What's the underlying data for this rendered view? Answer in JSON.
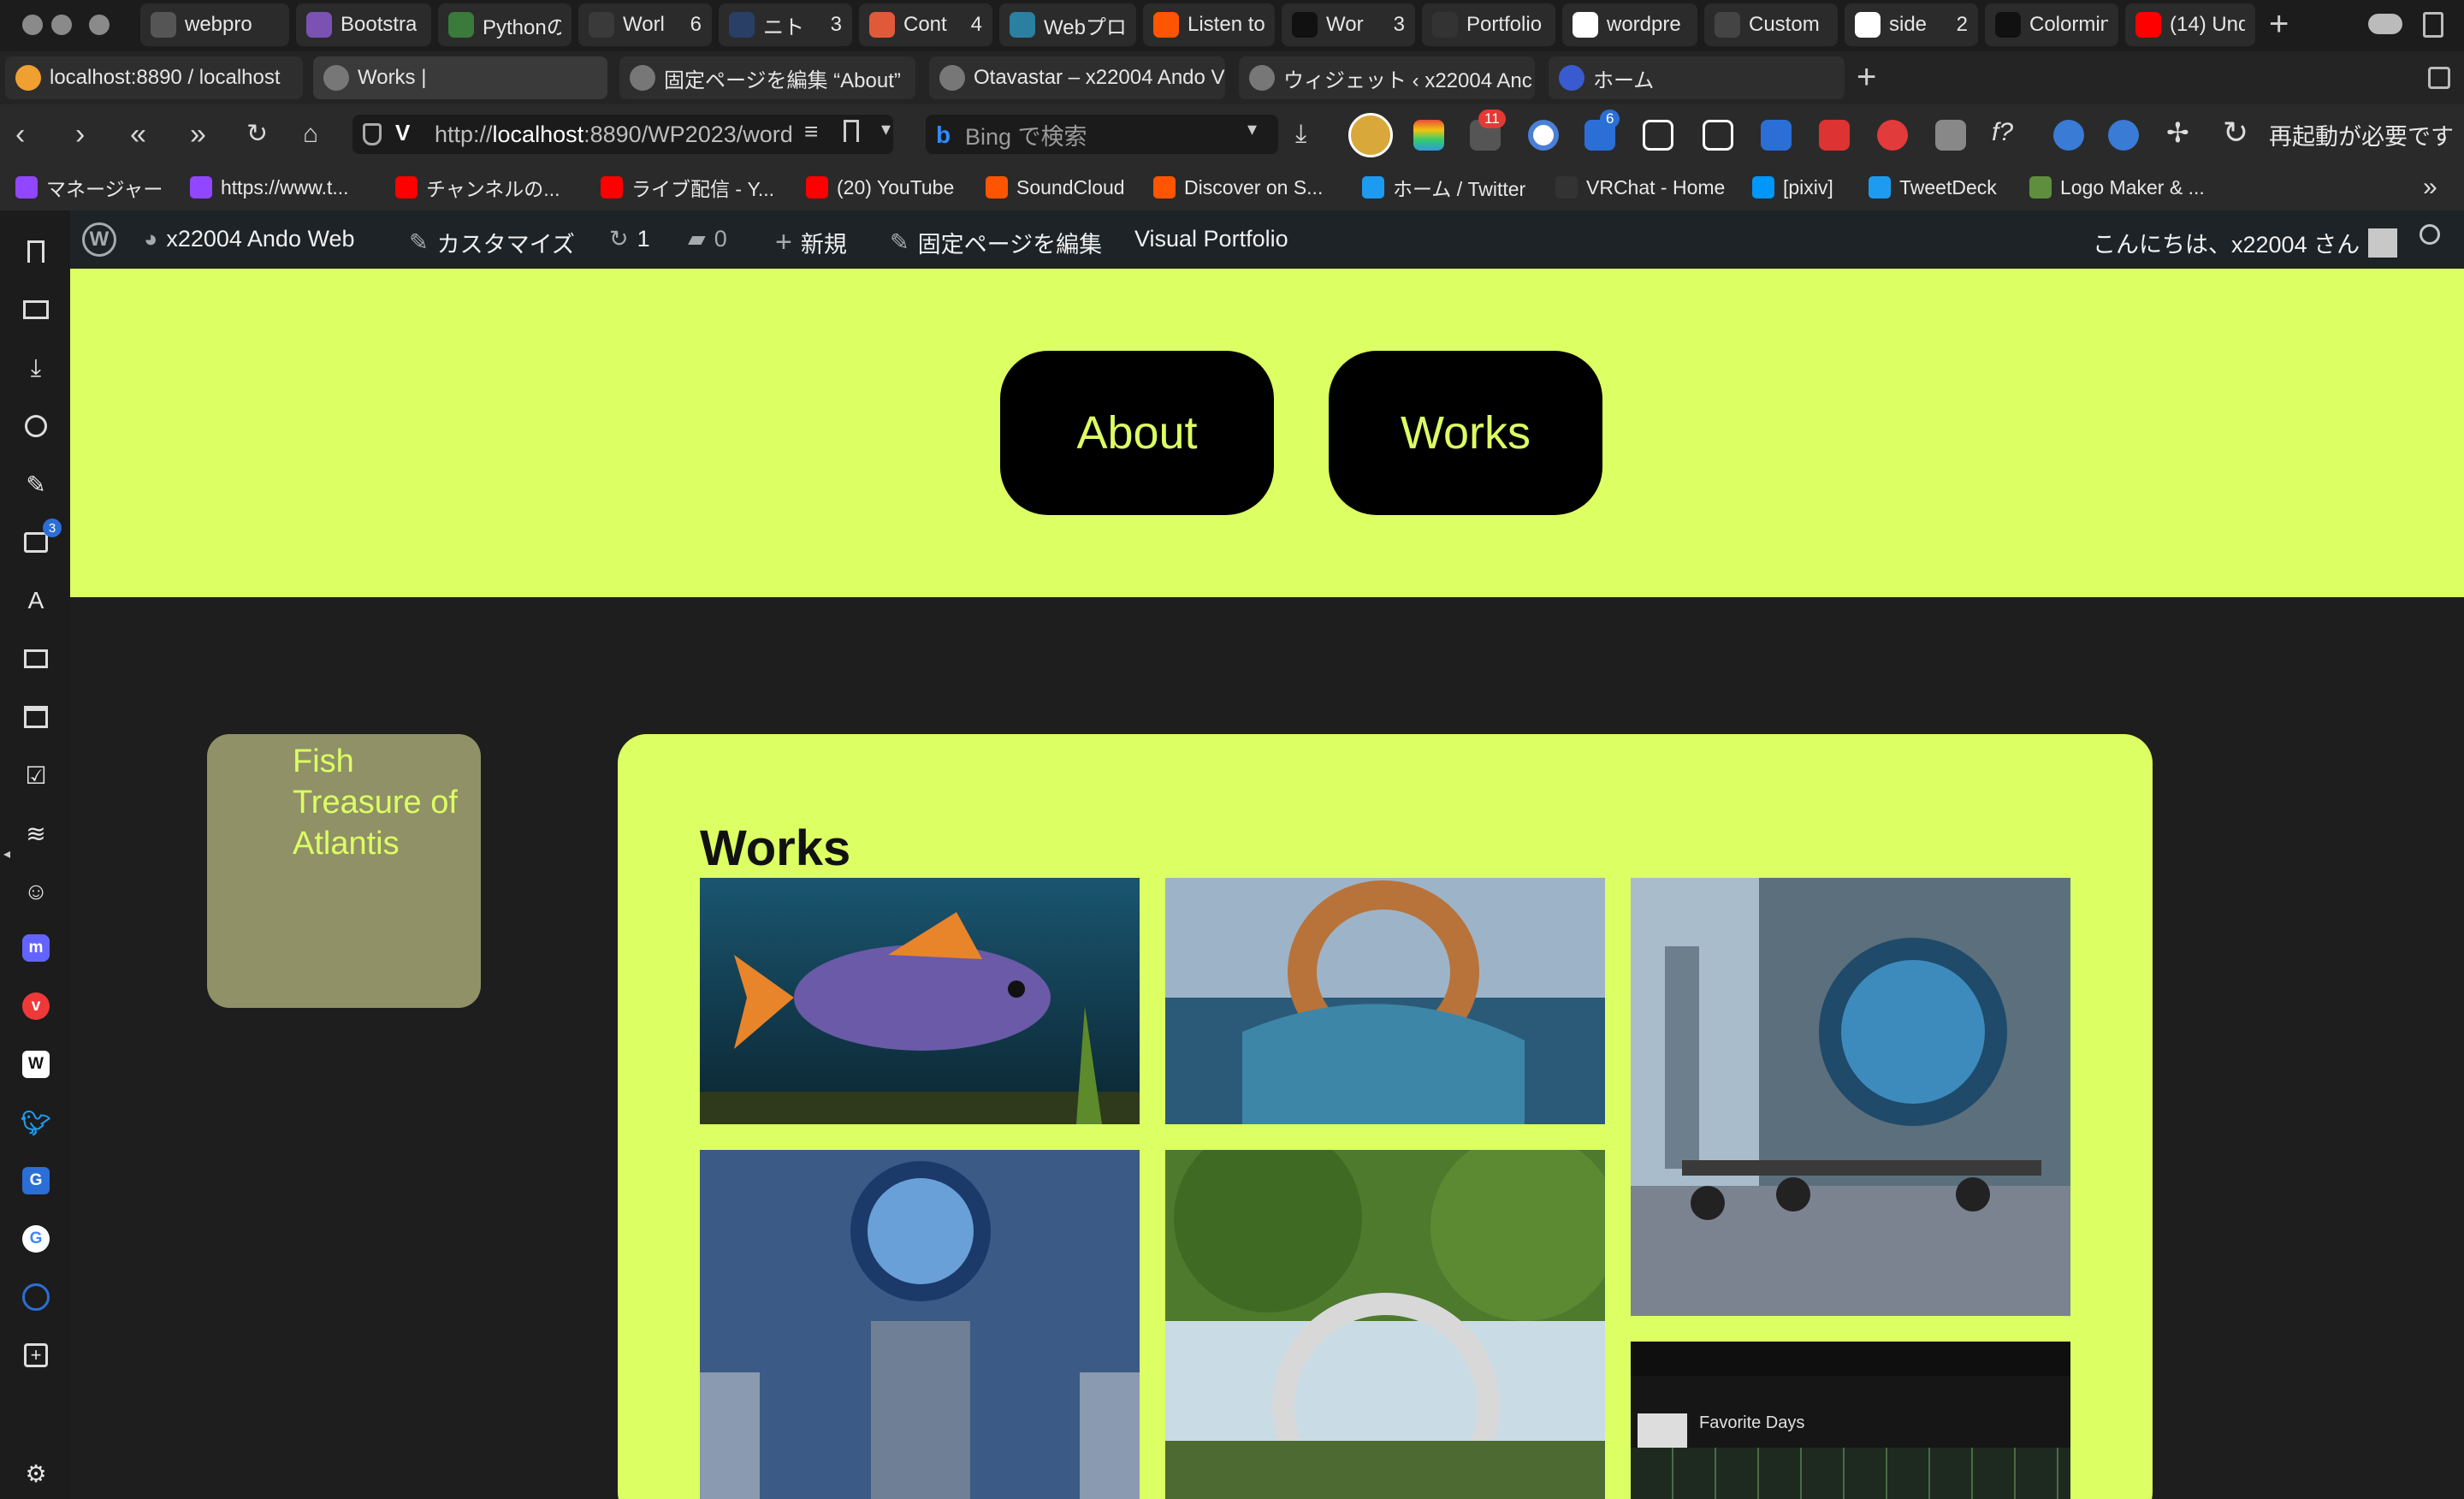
{
  "tabstrip": {
    "tabs": [
      {
        "label": "webpro",
        "count": "",
        "icon": "workspace-icon",
        "color": "#555555"
      },
      {
        "label": "Bootstra",
        "count": "",
        "icon": "bootstrap-icon",
        "color": "#7952b3"
      },
      {
        "label": "Pythonの",
        "count": "",
        "icon": "python-icon",
        "color": "#3a7a3a"
      },
      {
        "label": "Worl",
        "count": "6",
        "icon": "wordpress-icon",
        "color": "#3a3a3a"
      },
      {
        "label": "ニト",
        "count": "3",
        "icon": "search-icon",
        "color": "#2a3f66"
      },
      {
        "label": "Cont",
        "count": "4",
        "icon": "eg-icon",
        "color": "#e05a3a"
      },
      {
        "label": "Webプロ",
        "count": "",
        "icon": "sp-icon",
        "color": "#2b7fa1"
      },
      {
        "label": "Listen to",
        "count": "",
        "icon": "soundcloud-icon",
        "color": "#ff5500"
      },
      {
        "label": "Wor",
        "count": "3",
        "icon": "github-icon",
        "color": "#111111"
      },
      {
        "label": "Portfolio",
        "count": "",
        "icon": "portfolio-icon",
        "color": "#333333"
      },
      {
        "label": "wordpre",
        "count": "",
        "icon": "google-icon",
        "color": "#ffffff"
      },
      {
        "label": "Custom",
        "count": "",
        "icon": "doc-icon",
        "color": "#444444"
      },
      {
        "label": "side",
        "count": "2",
        "icon": "google-icon",
        "color": "#ffffff"
      },
      {
        "label": "Colormin",
        "count": "",
        "icon": "colormind-icon",
        "color": "#111111"
      },
      {
        "label": "(14) Und",
        "count": "",
        "icon": "youtube-icon",
        "color": "#ff0000"
      }
    ]
  },
  "tabrow2": {
    "tabs": [
      {
        "label": "localhost:8890 / localhost",
        "icon": "phpmyadmin-icon"
      },
      {
        "label": "Works |",
        "icon": "wordpress-icon"
      },
      {
        "label": "固定ページを編集 “About”",
        "icon": "wordpress-icon"
      },
      {
        "label": "Otavastar – x22004 Ando V",
        "icon": "wordpress-icon"
      },
      {
        "label": "ウィジェット ‹ x22004 Anc",
        "icon": "wordpress-icon"
      },
      {
        "label": "ホーム",
        "icon": "home-site-icon"
      }
    ]
  },
  "address": {
    "url_host": "localhost",
    "url_prefix": "http://",
    "url_suffix": ":8890/WP2023/word",
    "search_placeholder": "Bing で検索",
    "restart_label": "再起動が必要です",
    "ext_badge_1": "11",
    "ext_badge_2": "6"
  },
  "bookmarks": [
    {
      "label": "マネージャー",
      "icon": "twitch-icon",
      "color": "#9146ff"
    },
    {
      "label": "https://www.t...",
      "icon": "twitch-icon",
      "color": "#9146ff"
    },
    {
      "label": "チャンネルの...",
      "icon": "youtube-icon",
      "color": "#ff0000"
    },
    {
      "label": "ライブ配信 - Y...",
      "icon": "youtube-icon",
      "color": "#ff0000"
    },
    {
      "label": "(20) YouTube",
      "icon": "youtube-icon",
      "color": "#ff0000"
    },
    {
      "label": "SoundCloud",
      "icon": "soundcloud-icon",
      "color": "#ff5500"
    },
    {
      "label": "Discover on S...",
      "icon": "soundcloud-icon",
      "color": "#ff5500"
    },
    {
      "label": "ホーム / Twitter",
      "icon": "twitter-icon",
      "color": "#1d9bf0"
    },
    {
      "label": "VRChat - Home",
      "icon": "vrchat-icon",
      "color": "#333333"
    },
    {
      "label": "[pixiv]",
      "icon": "pixiv-icon",
      "color": "#0096fa"
    },
    {
      "label": "TweetDeck",
      "icon": "tweetdeck-icon",
      "color": "#1d9bf0"
    },
    {
      "label": "Logo Maker & ...",
      "icon": "shopify-icon",
      "color": "#5e8e3e"
    }
  ],
  "wpadmin": {
    "site_name": "x22004 Ando Web",
    "customize": "カスタマイズ",
    "updates": "1",
    "comments": "0",
    "new": "新規",
    "edit_page": "固定ページを編集",
    "plugin": "Visual Portfolio",
    "greeting": "こんにちは、x22004 さん"
  },
  "sidebar": {
    "badge": "3"
  },
  "hero": {
    "nav": [
      {
        "label": "About"
      },
      {
        "label": "Works"
      }
    ]
  },
  "content": {
    "card_label": "Fish\nTreasure of\nAtlantis",
    "works_title": "Works",
    "thumb_caption": "Favorite Days"
  },
  "colors": {
    "accent": "#dcff63",
    "card": "#909166",
    "dark": "#1e1e1e"
  }
}
